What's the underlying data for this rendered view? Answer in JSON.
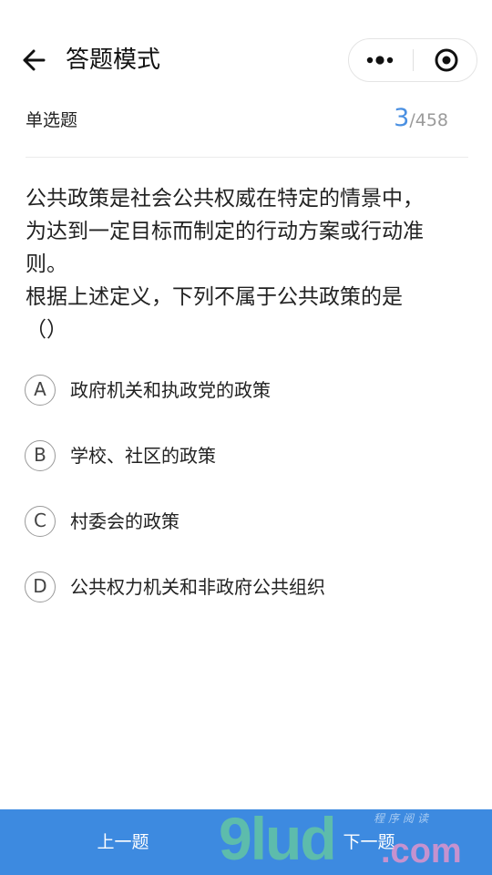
{
  "nav": {
    "title": "答题模式",
    "back_icon": "back-arrow-icon",
    "more_icon": "more-dots-icon",
    "close_icon": "target-close-icon"
  },
  "quiz": {
    "type_label": "单选题",
    "current": "3",
    "total": "/458",
    "accent_color": "#4a90e2"
  },
  "question": {
    "lines": [
      "公共政策是社会公共权威在特定的情景中，",
      "为达到一定目标而制定的行动方案或行动准",
      "则。",
      "根据上述定义，下列不属于公共政策的是",
      "（）"
    ]
  },
  "options": [
    {
      "letter": "A",
      "text": "政府机关和执政党的政策"
    },
    {
      "letter": "B",
      "text": "学校、社区的政策"
    },
    {
      "letter": "C",
      "text": "村委会的政策"
    },
    {
      "letter": "D",
      "text": "公共权力机关和非政府公共组织"
    }
  ],
  "bottom": {
    "prev_label": "上一题",
    "next_label": "下一题",
    "bar_color": "#3d8ae0"
  },
  "watermark": {
    "logo": "9lud",
    "domain": ".com",
    "caption": "程序阅读"
  }
}
